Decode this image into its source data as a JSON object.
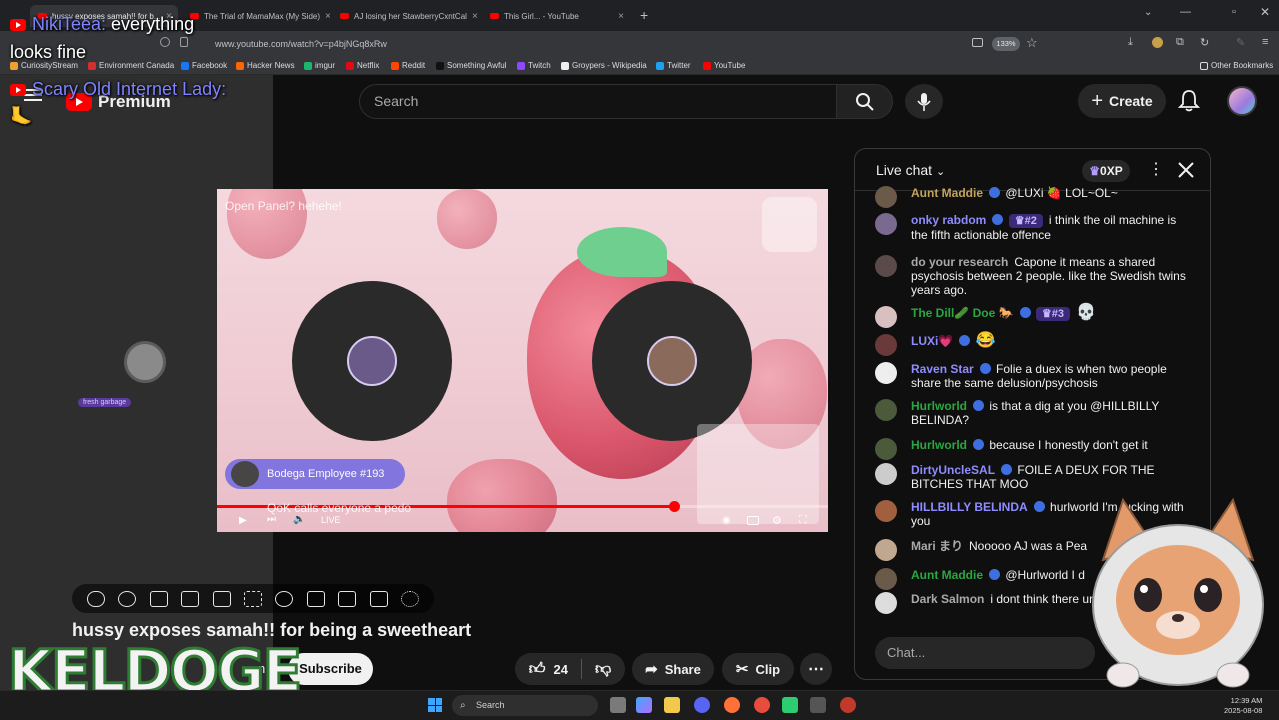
{
  "browser": {
    "tabs": [
      {
        "title": "hussy exposes samah!! for b..."
      },
      {
        "title": "The Trial of MamaMax (My Side)"
      },
      {
        "title": "AJ losing her StawberryCxntCal"
      },
      {
        "title": "This Girl... - YouTube"
      }
    ],
    "url": "www.youtube.com/watch?v=p4bjNGq8xRw",
    "zoom": "133%",
    "bookmarks": [
      {
        "label": "CuriosityStream",
        "color": "#f0a030"
      },
      {
        "label": "Environment Canada",
        "color": "#d32f2f"
      },
      {
        "label": "Facebook",
        "color": "#1877f2"
      },
      {
        "label": "Hacker News",
        "color": "#ff6600"
      },
      {
        "label": "imgur",
        "color": "#1bb76e"
      },
      {
        "label": "Netflix",
        "color": "#e50914"
      },
      {
        "label": "Reddit",
        "color": "#ff4500"
      },
      {
        "label": "Something Awful",
        "color": "#111111"
      },
      {
        "label": "Twitch",
        "color": "#9146ff"
      },
      {
        "label": "Groypers - Wikipedia",
        "color": "#eeeeee"
      },
      {
        "label": "Twitter",
        "color": "#1da1f2"
      },
      {
        "label": "YouTube",
        "color": "#ff0000"
      }
    ],
    "other_bookmarks": "Other Bookmarks"
  },
  "youtube": {
    "premium_label": "Premium",
    "search_placeholder": "Search",
    "create_label": "Create",
    "video_title": "hussy exposes samah!! for being a sweetheart",
    "subscribe_label": "Subscribe",
    "likes": "24",
    "share_label": "Share",
    "clip_label": "Clip",
    "channel_tail": "n"
  },
  "video": {
    "panel_text": "Open Panel? hehehe!",
    "speaker_name": "Bodega Employee #193",
    "caption": "QoK calls everyone a pedo",
    "live_label": "LIVE",
    "progress_fraction": 0.748
  },
  "overlay": {
    "chat1_name": "NikiTeea:",
    "chat1_text": "everything",
    "chat1_text2": "looks fine",
    "chat2_name": "Scary Old Internet Lady:",
    "chat2_emoji": "🦶",
    "keldoge": "KELDOGE",
    "tag": "fresh garbage"
  },
  "chat": {
    "title": "Live chat",
    "xp": "0XP",
    "input_placeholder": "Chat...",
    "messages": [
      {
        "name": "Aunt Maddie",
        "color": "#c5a35a",
        "text": "@LUXi 🍓 LOL~OL~",
        "avatar": "#6b5a4a"
      },
      {
        "name": "onky rabdom",
        "color": "#8f8cff",
        "rank": "#2",
        "text": "i think the oil machine is the fifth actionable offence",
        "avatar": "#7a6a90"
      },
      {
        "name": "do your research",
        "color": "#aaaaaa",
        "text": "Capone it means a shared psychosis between 2 people. like the Swedish twins years ago.",
        "avatar": "#5a4a4a"
      },
      {
        "name": "The Dill🥒 Doe 🐎",
        "color": "#2ba640",
        "rank": "#3",
        "text": "💀",
        "avatar": "#d9c0c0"
      },
      {
        "name": "LUXi💗",
        "color": "#8f8cff",
        "text": "😂",
        "avatar": "#6a3a3a"
      },
      {
        "name": "Raven Star",
        "color": "#8f8cff",
        "text": "Folie a duex is when two people share the same delusion/psychosis",
        "avatar": "#eeeeee"
      },
      {
        "name": "Hurlworld",
        "color": "#2ba640",
        "text": "is that a dig at you @HILLBILLY BELINDA?",
        "avatar": "#4a5a3a"
      },
      {
        "name": "Hurlworld",
        "color": "#2ba640",
        "text": "because I honestly don't get it",
        "avatar": "#4a5a3a"
      },
      {
        "name": "DirtyUncleSAL",
        "color": "#8f8cff",
        "text": "FOILE A DEUX FOR THE BITCHES THAT MOO",
        "avatar": "#cccccc"
      },
      {
        "name": "HILLBILLY BELINDA",
        "color": "#8f8cff",
        "text": "hurlworld I'm fucking with you",
        "avatar": "#a06040"
      },
      {
        "name": "Mari まり",
        "color": "#aaaaaa",
        "text": "Nooooo AJ was a Pea",
        "avatar": "#c0a890"
      },
      {
        "name": "Aunt Maddie",
        "color": "#2ba640",
        "text": "@Hurlworld I d",
        "avatar": "#6b5a4a"
      },
      {
        "name": "Dark Salmon",
        "color": "#aaaaaa",
        "text": "i dont think there understand honestly",
        "avatar": "#dddddd"
      }
    ]
  },
  "taskbar": {
    "search_label": "Search",
    "time": "12:39 AM",
    "date": "2025-08-08"
  },
  "colors": {
    "brand_red": "#ff0000",
    "accent_purple": "#8f8cff",
    "accent_green": "#2ba640"
  }
}
